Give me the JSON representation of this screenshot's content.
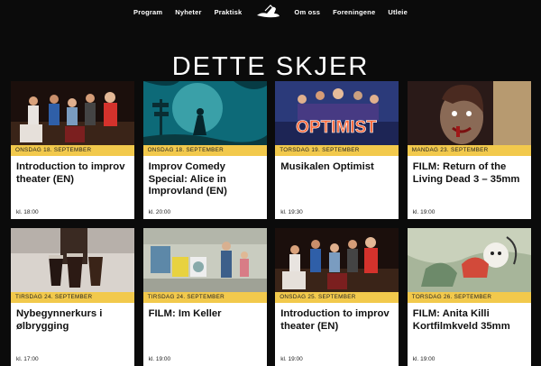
{
  "nav": {
    "left": [
      "Program",
      "Nyheter",
      "Praktisk"
    ],
    "right": [
      "Om oss",
      "Foreningene",
      "Utleie"
    ],
    "logo_icon": "hat-logo-icon"
  },
  "page_title": "DETTE SKJER",
  "colors": {
    "background": "#0b0b0b",
    "date_strip": "#f2c94c",
    "card": "#ffffff"
  },
  "events": [
    {
      "date": "ONSDAG 18. SEPTEMBER",
      "title": "Introduction to improv theater (EN)",
      "time": "kl. 18:00",
      "image": "improv-group-stage-photo"
    },
    {
      "date": "ONSDAG 18. SEPTEMBER",
      "title": "Improv Comedy Special: Alice in Improvland (EN)",
      "time": "kl. 20:00",
      "image": "alice-forest-illustration"
    },
    {
      "date": "TORSDAG 19. SEPTEMBER",
      "title": "Musikalen Optimist",
      "time": "kl. 19:30",
      "image": "optimist-poster"
    },
    {
      "date": "MANDAG 23. SEPTEMBER",
      "title": "FILM: Return of the Living Dead 3 – 35mm",
      "time": "kl. 19:00",
      "image": "zombie-film-still"
    },
    {
      "date": "TIRSDAG 24. SEPTEMBER",
      "title": "Nybegynnerkurs i ølbrygging",
      "time": "kl. 17:00",
      "image": "beer-glasses-photo"
    },
    {
      "date": "TIRSDAG 24. SEPTEMBER",
      "title": "FILM: Im Keller",
      "time": "kl. 19:00",
      "image": "basement-laundry-still"
    },
    {
      "date": "ONSDAG 25. SEPTEMBER",
      "title": "Introduction to improv theater (EN)",
      "time": "kl. 19:00",
      "image": "improv-group-stage-photo"
    },
    {
      "date": "TORSDAG 26. SEPTEMBER",
      "title": "FILM: Anita Killi Kortfilmkveld 35mm",
      "time": "kl. 19:00",
      "image": "animated-film-still"
    }
  ]
}
